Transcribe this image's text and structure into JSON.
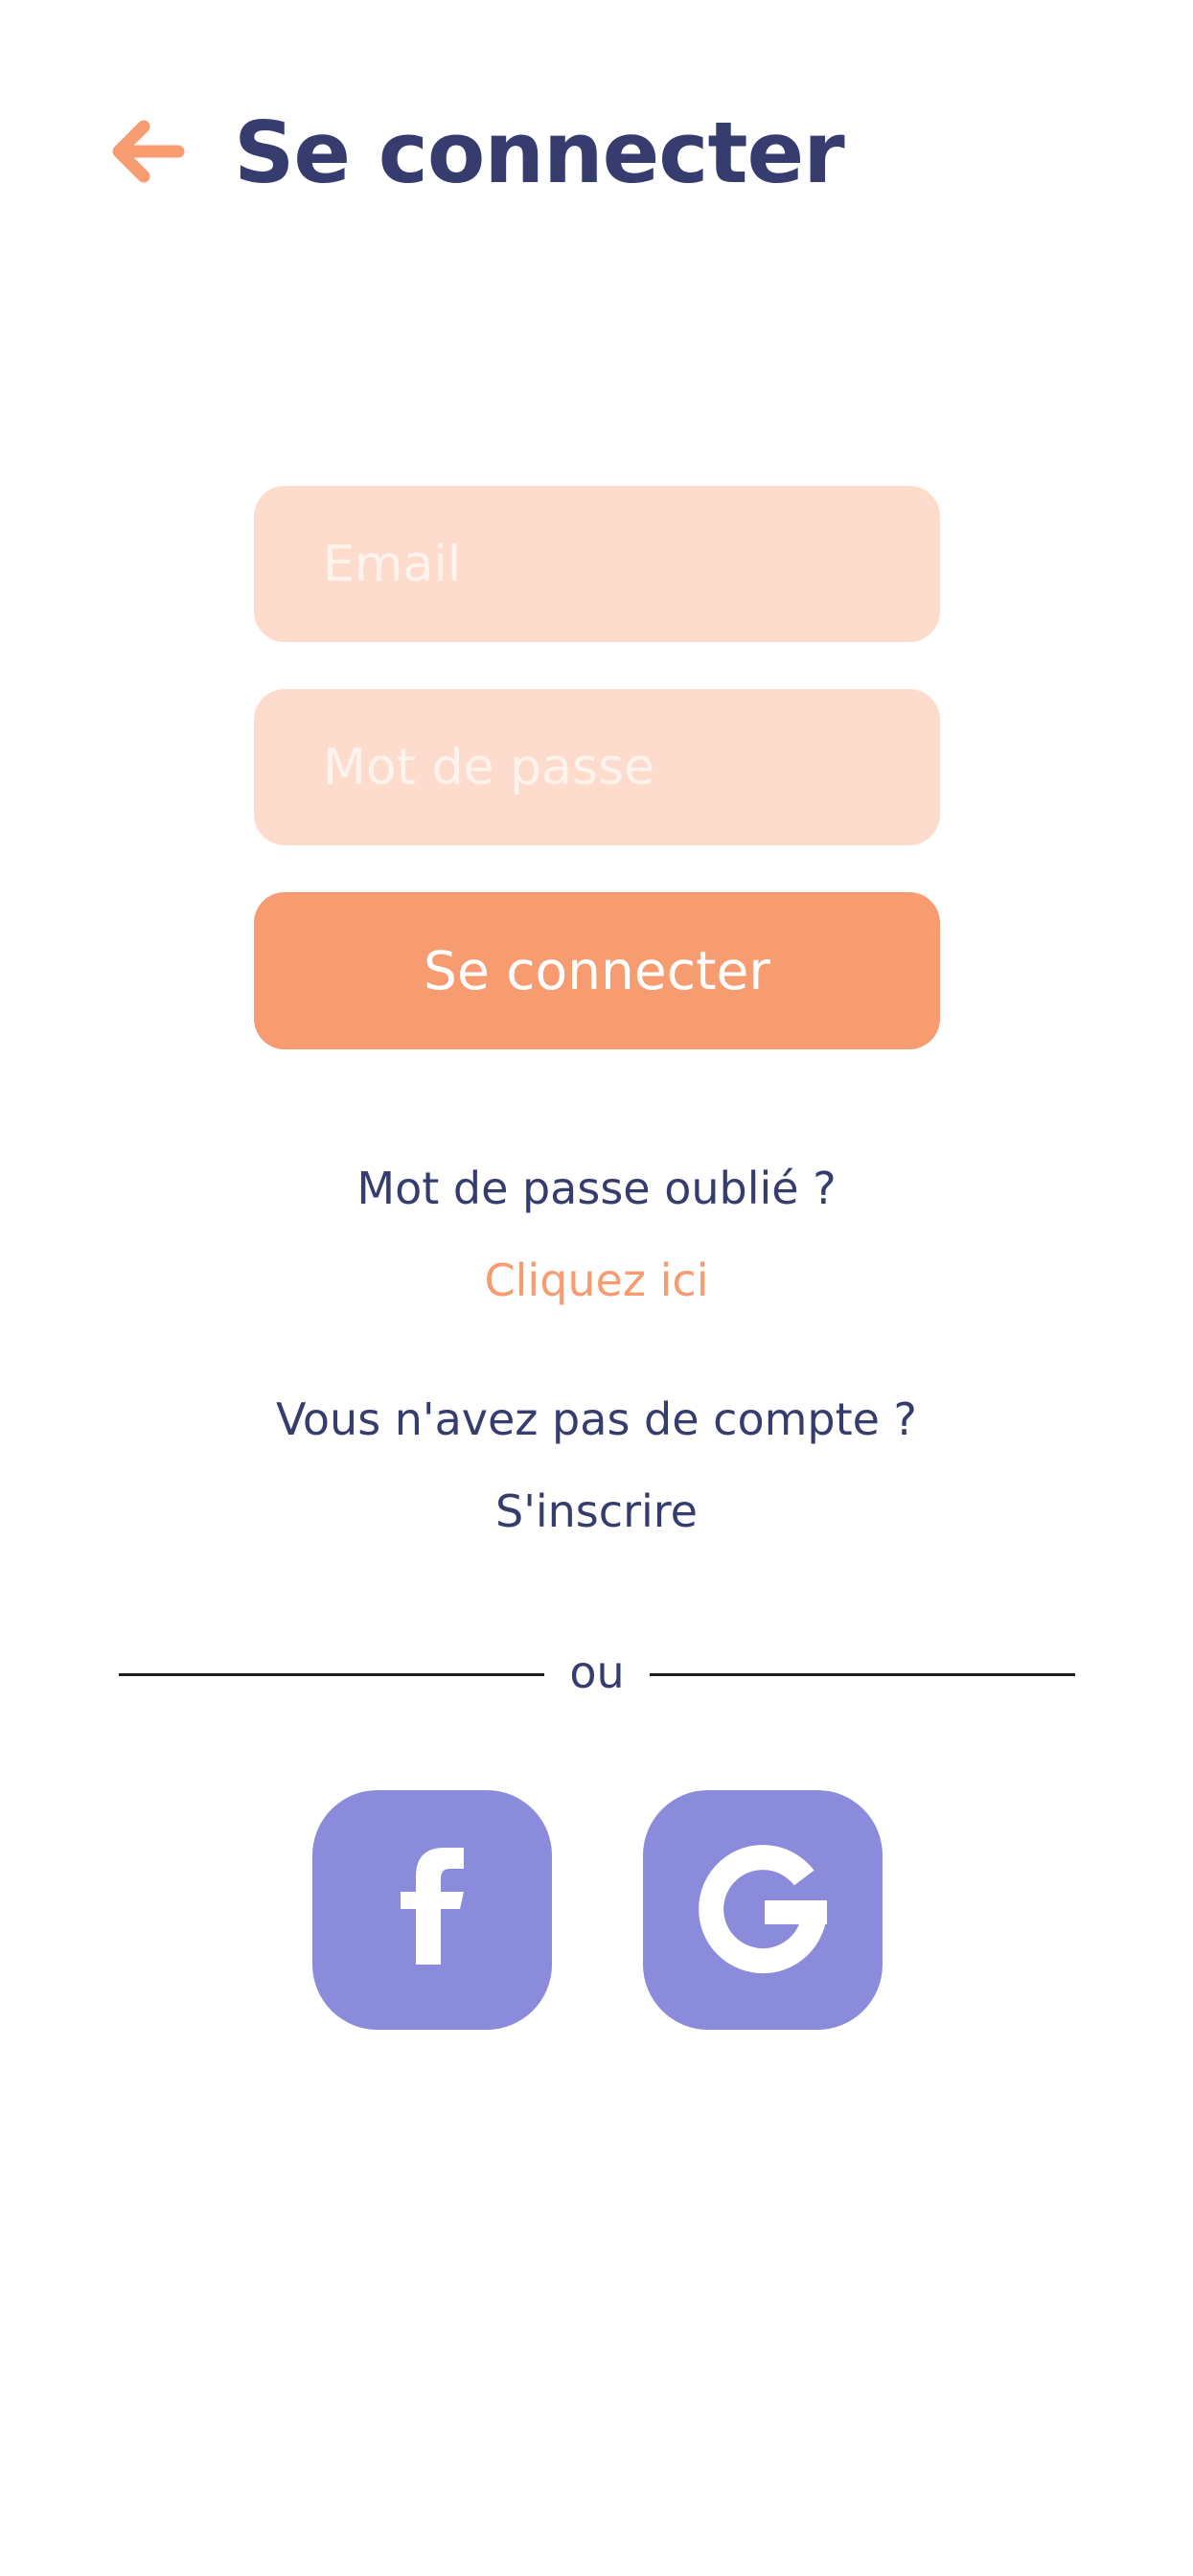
{
  "header": {
    "title": "Se connecter",
    "back_icon": "arrow-left-icon"
  },
  "form": {
    "email_placeholder": "Email",
    "password_placeholder": "Mot de passe",
    "submit_label": "Se connecter"
  },
  "links": {
    "forgot_text": "Mot de passe oublié ?",
    "forgot_link": "Cliquez ici",
    "signup_text": "Vous n'avez pas de compte ?",
    "signup_link": "S'inscrire"
  },
  "divider": {
    "label": "ou"
  },
  "social": {
    "facebook_icon": "facebook-icon",
    "google_icon": "google-icon"
  },
  "colors": {
    "primary_text": "#363c6e",
    "accent": "#f79b71",
    "field_background": "#fddbcd",
    "social_background": "#8a8bdb"
  }
}
